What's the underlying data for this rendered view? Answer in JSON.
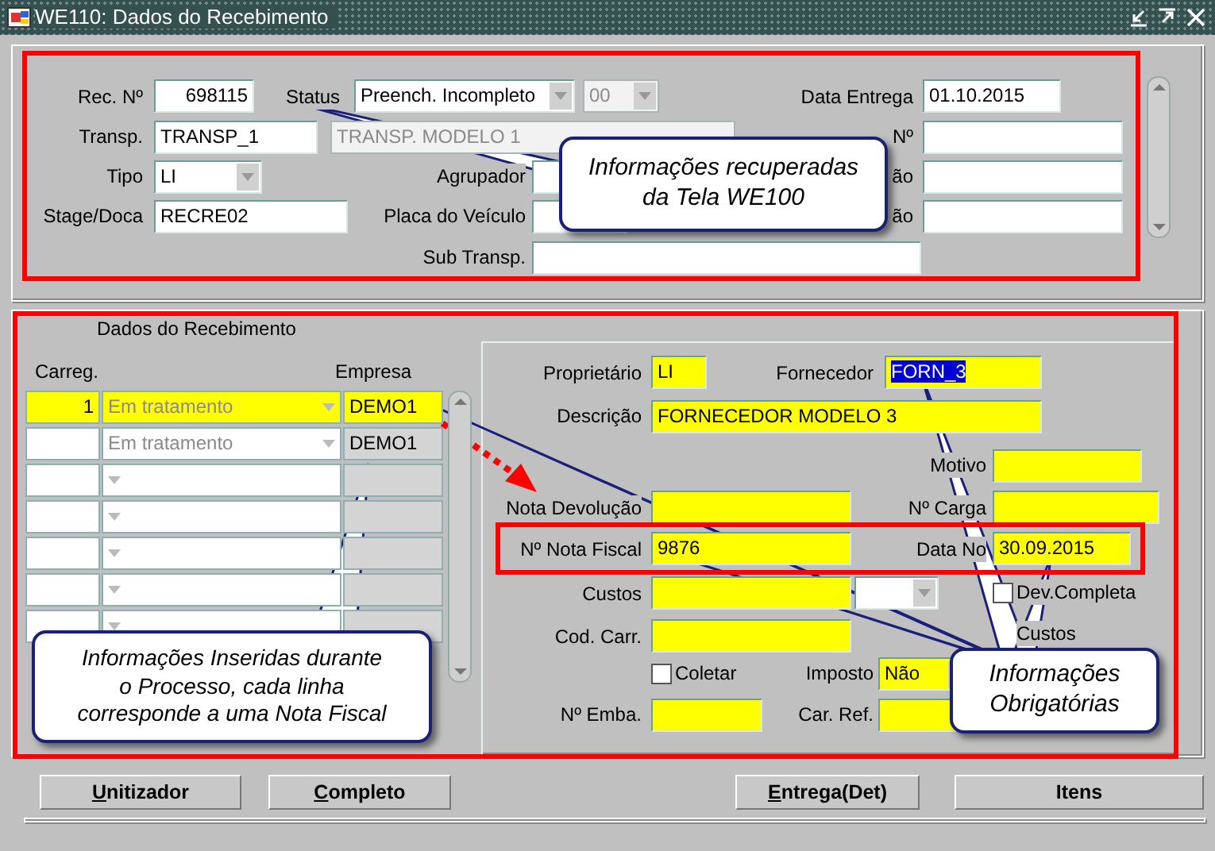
{
  "window": {
    "title": "WE110: Dados do Recebimento"
  },
  "header": {
    "labels": [
      "Rec. Nº",
      "Status",
      "Data Entrega",
      "Transp.",
      "Nº",
      "Tipo",
      "Agrupador",
      "ão",
      "Stage/Doca",
      "Placa do Veículo",
      "ão",
      "Sub Transp."
    ],
    "fields": [
      {
        "kind": "text",
        "value": "698115",
        "disabled": false
      },
      {
        "kind": "dropdown",
        "value": "Preench. Incompleto",
        "disabled": false
      },
      {
        "kind": "dropdown",
        "value": "00",
        "disabled": true
      },
      {
        "kind": "text",
        "value": "01.10.2015",
        "disabled": false
      },
      {
        "kind": "text",
        "value": "TRANSP_1",
        "disabled": false
      },
      {
        "kind": "text",
        "value": "TRANSP. MODELO 1",
        "disabled": true
      },
      {
        "kind": "text",
        "disabled": false
      },
      {
        "kind": "dropdown",
        "value": "LI",
        "disabled": false
      },
      {
        "kind": "text",
        "disabled": false
      },
      {
        "kind": "text",
        "disabled": false
      },
      {
        "kind": "text",
        "value": "RECRE02",
        "disabled": false
      },
      {
        "kind": "text",
        "disabled": false
      },
      {
        "kind": "text",
        "disabled": false
      },
      {
        "kind": "text",
        "disabled": false
      }
    ]
  },
  "group_title": "Dados do Recebimento",
  "grid": {
    "columns": [
      "Carreg.",
      "Empresa"
    ],
    "rows": [
      {
        "selected": true,
        "carreg": "1",
        "status": "Em tratamento",
        "empresa": "DEMO1"
      },
      {
        "selected": false,
        "status": "Em tratamento",
        "empresa": "DEMO1"
      },
      {
        "selected": false
      },
      {
        "selected": false
      },
      {
        "selected": false
      },
      {
        "selected": false
      },
      {
        "selected": false
      }
    ]
  },
  "details": {
    "labels": [
      "Proprietário",
      "Fornecedor",
      "Descrição",
      "Motivo",
      "Nota Devolução",
      "Nº Carga",
      "Nº Nota Fiscal",
      "Data No",
      "Custos",
      "Cod. Carr.",
      "Custos",
      "Imposto",
      "Nº Emba.",
      "Car. Ref."
    ],
    "checkboxes": [
      {
        "label": "Dev.Completa",
        "checked": false
      },
      {
        "label": "Coletar",
        "checked": false
      }
    ],
    "fields": [
      {
        "kind": "text",
        "value": "LI",
        "required": true,
        "text_selected": false
      },
      {
        "kind": "text",
        "value": "FORN_3",
        "required": true,
        "text_selected": true
      },
      {
        "kind": "text",
        "value": "FORNECEDOR MODELO 3",
        "required": true,
        "text_selected": false
      },
      {
        "kind": "text",
        "required": true,
        "text_selected": false
      },
      {
        "kind": "text",
        "required": true,
        "text_selected": false
      },
      {
        "kind": "text",
        "required": true,
        "text_selected": false
      },
      {
        "kind": "text",
        "value": "9876",
        "required": true,
        "text_selected": false
      },
      {
        "kind": "text",
        "value": "30.09.2015",
        "required": true,
        "text_selected": false
      },
      {
        "kind": "text",
        "required": true,
        "text_selected": false
      },
      {
        "kind": "dropdown",
        "required": false,
        "text_selected": false
      },
      {
        "kind": "text",
        "required": true,
        "text_selected": false
      },
      {
        "kind": "dropdown",
        "value": "Não",
        "required": true,
        "text_selected": false
      },
      {
        "kind": "text",
        "required": true,
        "text_selected": false
      },
      {
        "kind": "text",
        "required": true,
        "text_selected": false
      }
    ]
  },
  "annotations": [
    "Informações recuperadas da Tela WE100",
    "Informações Inseridas durante o Processo, cada linha corresponde a uma Nota Fiscal",
    "Informações Obrigatórias"
  ],
  "buttons": [
    {
      "label": "Unitizador",
      "underline_first": true
    },
    {
      "label": "Completo",
      "underline_first": true
    },
    {
      "label": "Entrega(Det)",
      "underline_first": true
    },
    {
      "label": "Itens",
      "underline_first": false
    }
  ]
}
